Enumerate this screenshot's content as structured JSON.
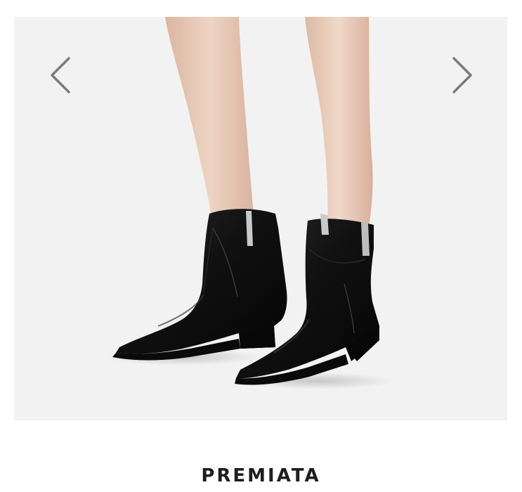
{
  "product": {
    "brand": "PREMIATA"
  },
  "gallery": {
    "prev_icon": "chevron-left-icon",
    "next_icon": "chevron-right-icon",
    "arrow_color": "#7a7a7a",
    "background_color": "#f2f2f2"
  },
  "colors": {
    "boot": "#141414",
    "skin": "#e8c9b6",
    "pull_tab": "#c9c9c9"
  }
}
